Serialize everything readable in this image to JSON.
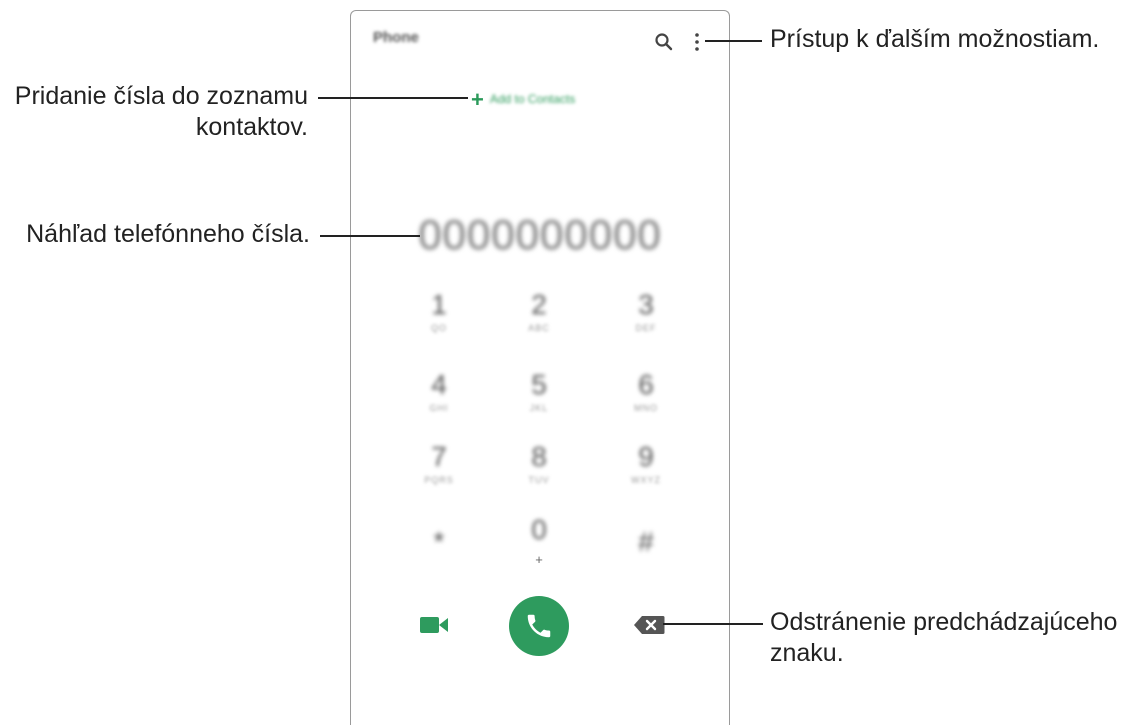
{
  "phone": {
    "app_title": "Phone",
    "add_to_contacts": "Add to Contacts",
    "number_preview": "0000000000",
    "keypad": [
      {
        "digit": "1",
        "letters": "QO"
      },
      {
        "digit": "2",
        "letters": "ABC"
      },
      {
        "digit": "3",
        "letters": "DEF"
      },
      {
        "digit": "4",
        "letters": "GHI"
      },
      {
        "digit": "5",
        "letters": "JKL"
      },
      {
        "digit": "6",
        "letters": "MNO"
      },
      {
        "digit": "7",
        "letters": "PQRS"
      },
      {
        "digit": "8",
        "letters": "TUV"
      },
      {
        "digit": "9",
        "letters": "WXYZ"
      },
      {
        "digit": "*",
        "letters": ""
      },
      {
        "digit": "0",
        "letters": "+"
      },
      {
        "digit": "#",
        "letters": ""
      }
    ],
    "colors": {
      "accent": "#2e9b5e",
      "icon": "#555555"
    }
  },
  "callouts": {
    "more_options": "Prístup k ďalším možnostiam.",
    "add_contact_line1": "Pridanie čísla do zoznamu",
    "add_contact_line2": "kontaktov.",
    "preview": "Náhľad telefónneho čísla.",
    "delete_line1": "Odstránenie predchádzajúceho",
    "delete_line2": "znaku."
  }
}
